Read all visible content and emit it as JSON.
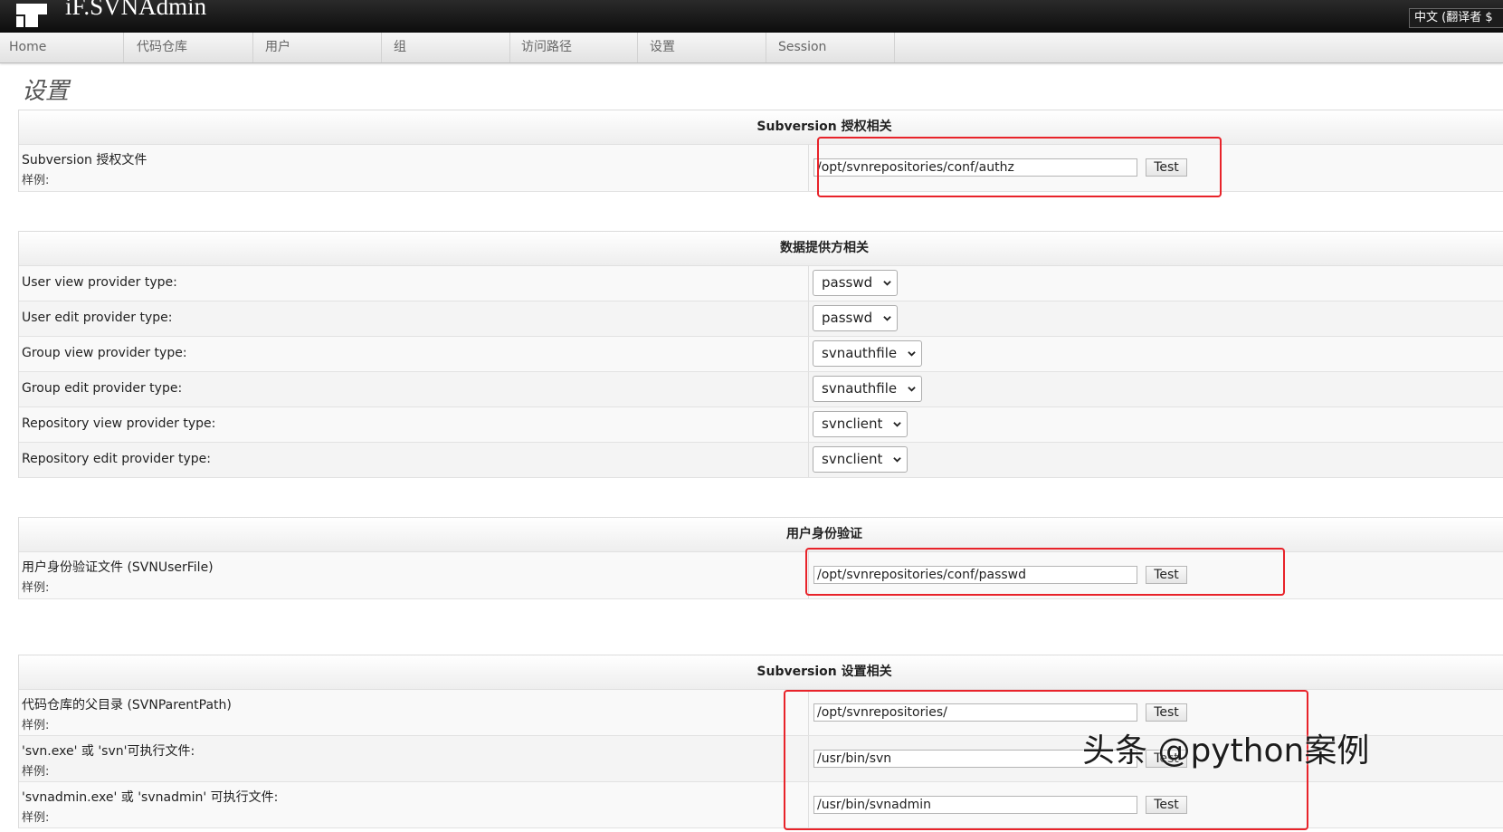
{
  "app": {
    "title": "iF.SVNAdmin",
    "language": "中文 (翻译者 $"
  },
  "nav": {
    "items": [
      {
        "label": "Home"
      },
      {
        "label": "代码仓库"
      },
      {
        "label": "用户"
      },
      {
        "label": "组"
      },
      {
        "label": "访问路径"
      },
      {
        "label": "设置"
      },
      {
        "label": "Session"
      }
    ]
  },
  "page": {
    "title": "设置"
  },
  "sections": {
    "authz": {
      "header": "Subversion 授权相关",
      "rows": [
        {
          "label": "Subversion 授权文件",
          "sub": "样例:",
          "value": "/opt/svnrepositories/conf/authz",
          "button": "Test"
        }
      ]
    },
    "provider": {
      "header": "数据提供方相关",
      "rows": [
        {
          "label": "User view provider type:",
          "value": "passwd"
        },
        {
          "label": "User edit provider type:",
          "value": "passwd"
        },
        {
          "label": "Group view provider type:",
          "value": "svnauthfile"
        },
        {
          "label": "Group edit provider type:",
          "value": "svnauthfile"
        },
        {
          "label": "Repository view provider type:",
          "value": "svnclient"
        },
        {
          "label": "Repository edit provider type:",
          "value": "svnclient"
        }
      ]
    },
    "auth": {
      "header": "用户身份验证",
      "rows": [
        {
          "label": "用户身份验证文件 (SVNUserFile)",
          "sub": "样例:",
          "value": "/opt/svnrepositories/conf/passwd",
          "button": "Test"
        }
      ]
    },
    "svn": {
      "header": "Subversion 设置相关",
      "rows": [
        {
          "label": "代码仓库的父目录 (SVNParentPath)",
          "sub": "样例:",
          "value": "/opt/svnrepositories/",
          "button": "Test"
        },
        {
          "label": "'svn.exe' 或 'svn'可执行文件:",
          "sub": "样例:",
          "value": "/usr/bin/svn",
          "button": "Test"
        },
        {
          "label": "'svnadmin.exe' 或 'svnadmin' 可执行文件:",
          "sub": "样例:",
          "value": "/usr/bin/svnadmin",
          "button": "Test"
        }
      ]
    }
  },
  "watermark": "头条 @python案例",
  "colors": {
    "highlight": "#e8232a",
    "header_bg": "#111111"
  }
}
